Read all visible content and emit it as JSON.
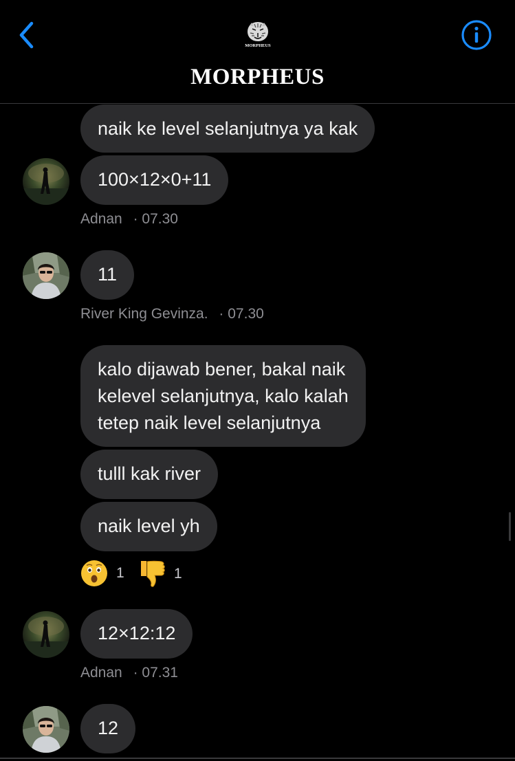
{
  "header": {
    "title": "MORPHEUS",
    "logo_text": "MORPHEUS",
    "back_icon": "chevron-left-icon",
    "info_icon": "info-circle-icon",
    "accent_color": "#1a8cff"
  },
  "messages": [
    {
      "text": "naik ke level selanjutnya ya kak"
    },
    {
      "text": "100×12×0+11"
    },
    {
      "text": "11"
    },
    {
      "text_lines": [
        "kalo dijawab bener, bakal naik",
        "kelevel selanjutnya, kalo kalah",
        "tetep naik level selanjutnya"
      ]
    },
    {
      "text": "tulll kak river"
    },
    {
      "text": "naik level yh"
    },
    {
      "text": "12×12:12"
    },
    {
      "text": "12"
    }
  ],
  "meta": [
    {
      "sender": "Adnan",
      "time": "· 07.30"
    },
    {
      "sender": "River King Gevinza.",
      "time": "· 07.30"
    },
    {
      "sender": "Adnan",
      "time": "· 07.31"
    }
  ],
  "reactions": [
    {
      "icon": "astonished-face-icon",
      "count": "1"
    },
    {
      "icon": "thumbs-down-icon",
      "count": "1"
    }
  ],
  "avatars": [
    {
      "user": "Adnan",
      "icon": "avatar-photo-night-park"
    },
    {
      "user": "River King Gevinza.",
      "icon": "avatar-photo-hoodie"
    }
  ]
}
